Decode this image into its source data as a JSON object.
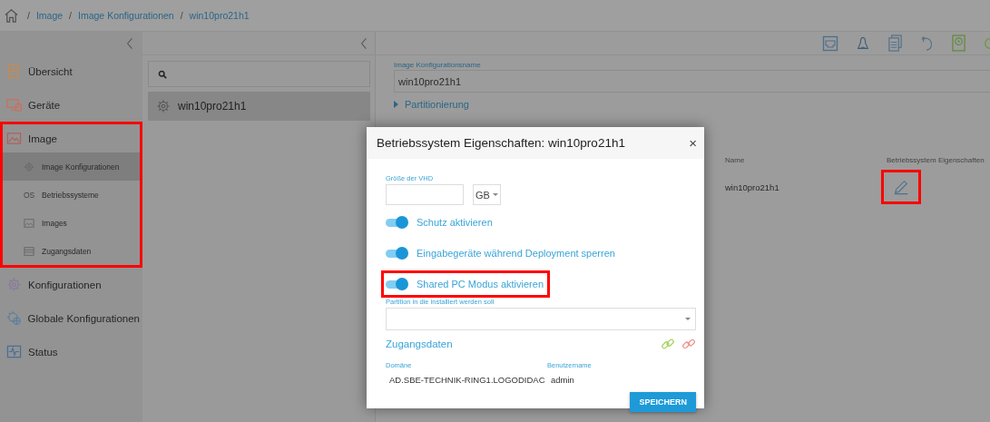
{
  "breadcrumb": [
    {
      "separator": "/",
      "label": "Image"
    },
    {
      "separator": "/",
      "label": "Image Konfigurationen"
    },
    {
      "separator": "/",
      "label": "win10pro21h1"
    }
  ],
  "sidebar": {
    "items": [
      {
        "label": "Übersicht",
        "selected": false,
        "highlighted": false
      },
      {
        "label": "Geräte",
        "selected": false,
        "highlighted": false
      },
      {
        "label": "Image",
        "selected": false,
        "highlighted": true,
        "children": [
          {
            "label": "Image Konfigurationen",
            "selected": true
          },
          {
            "label": "Betriebssysteme",
            "selected": false,
            "badge": "OS"
          },
          {
            "label": "Images",
            "selected": false
          },
          {
            "label": "Zugangsdaten",
            "selected": false
          }
        ]
      },
      {
        "label": "Konfigurationen",
        "selected": false,
        "highlighted": false
      },
      {
        "label": "Globale Konfigurationen",
        "selected": false,
        "highlighted": false
      },
      {
        "label": "Status",
        "selected": false,
        "highlighted": false
      }
    ]
  },
  "list": {
    "items": [
      {
        "label": "win10pro21h1",
        "selected": true
      }
    ]
  },
  "main": {
    "name_field": {
      "label": "Image Konfigurationsname",
      "value": "win10pro21h1"
    },
    "section": {
      "label": "Partitionierung",
      "expanded": false
    },
    "table": {
      "columns": [
        "Name",
        "Betriebssystem Eigenschaften"
      ],
      "rows": [
        {
          "name": "win10pro21h1",
          "edit_highlighted": true
        }
      ]
    }
  },
  "modal": {
    "title": "Betriebssystem Eigenschaften: win10pro21h1",
    "close": "×",
    "vhd": {
      "label": "Größe der VHD",
      "unit": "GB"
    },
    "toggles": [
      {
        "label": "Schutz aktivieren",
        "on": true,
        "highlighted": false
      },
      {
        "label": "Eingabegeräte während Deployment sperren",
        "on": true,
        "highlighted": false
      },
      {
        "label": "Shared PC Modus aktivieren",
        "on": true,
        "highlighted": true
      }
    ],
    "partition": {
      "label": "Partition in die installiert werden soll"
    },
    "credentials": "Zugangsdaten",
    "domain": {
      "label": "Domäne",
      "value": "AD.SBE-TECHNIK-RING1.LOGODIDAC"
    },
    "username": {
      "label": "Benutzername",
      "value": "admin"
    },
    "save": "SPEICHERN"
  }
}
